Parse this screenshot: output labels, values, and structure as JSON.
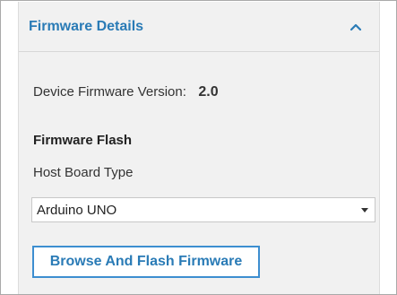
{
  "panel": {
    "title": "Firmware Details",
    "collapse_icon": "chevron-up-icon",
    "accent_color": "#2a7bb6"
  },
  "device": {
    "version_label": "Device Firmware Version:",
    "version_value": "2.0"
  },
  "flash": {
    "section_title": "Firmware Flash",
    "host_board_label": "Host Board Type",
    "host_board_selected": "Arduino UNO",
    "dropdown_icon": "caret-down-icon",
    "button_label": "Browse And Flash Firmware"
  }
}
